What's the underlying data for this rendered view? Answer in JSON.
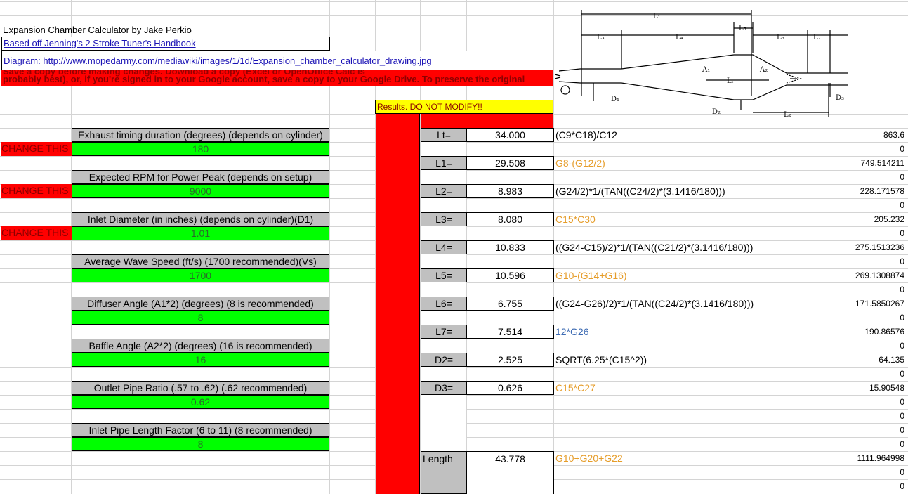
{
  "header": {
    "title": "Expansion Chamber Calculator by Jake Perkio",
    "source_link": "Based off Jenning's 2 Stroke Tuner's Handbook",
    "diagram_link": "Diagram: http://www.mopedarmy.com/mediawiki/images/1/1d/Expansion_chamber_calculator_drawing.jpg",
    "notice_text": "probably best), or, if you're signed in to your Google account, save a copy to your Google Drive. To preserve the original"
  },
  "change_label": "CHANGE THIS",
  "inputs": [
    {
      "label": "Exhaust timing duration (degrees) (depends on cylinder)",
      "value": "180",
      "required": true
    },
    {
      "label": "Expected RPM for Power Peak (depends on setup)",
      "value": "9000",
      "required": true
    },
    {
      "label": "Inlet Diameter (in inches) (depends on cylinder)(D1)",
      "value": "1.01",
      "required": true
    },
    {
      "label": "Average Wave Speed (ft/s) (1700 recommended)(Vs)",
      "value": "1700",
      "required": false
    },
    {
      "label": "Diffuser Angle (A1*2) (degrees) (8 is recommended)",
      "value": "8",
      "required": false
    },
    {
      "label": "Baffle Angle (A2*2) (degrees) (16 is recommended)",
      "value": "16",
      "required": false
    },
    {
      "label": "Outlet Pipe Ratio (.57 to .62) (.62 recommended)",
      "value": "0.62",
      "required": false
    },
    {
      "label": "Inlet Pipe Length Factor (6 to 11) (8 recommended)",
      "value": "8",
      "required": false
    }
  ],
  "results_header": "Results. DO NOT MODIFY!!",
  "results": [
    {
      "label": "Lt=",
      "value": "34.000",
      "formula": "(C9*C18)/C12",
      "formula_color": "black"
    },
    {
      "label": "L1=",
      "value": "29.508",
      "formula": "G8-(G12/2)",
      "formula_color": "orange"
    },
    {
      "label": "L2=",
      "value": "8.983",
      "formula": "(G24/2)*1/(TAN((C24/2)*(3.1416/180)))",
      "formula_color": "black"
    },
    {
      "label": "L3=",
      "value": "8.080",
      "formula": "C15*C30",
      "formula_color": "orange"
    },
    {
      "label": "L4=",
      "value": "10.833",
      "formula": "((G24-C15)/2)*1/(TAN((C21/2)*(3.1416/180)))",
      "formula_color": "black"
    },
    {
      "label": "L5=",
      "value": "10.596",
      "formula": "G10-(G14+G16)",
      "formula_color": "orange"
    },
    {
      "label": "L6=",
      "value": "6.755",
      "formula": "((G24-G26)/2)*1/(TAN((C24/2)*(3.1416/180)))",
      "formula_color": "black"
    },
    {
      "label": "L7=",
      "value": "7.514",
      "formula": "12*G26",
      "formula_color": "blue"
    },
    {
      "label": "D2=",
      "value": "2.525",
      "formula": "SQRT(6.25*(C15^2))",
      "formula_color": "black"
    },
    {
      "label": "D3=",
      "value": "0.626",
      "formula": "C15*C27",
      "formula_color": "orange"
    }
  ],
  "length_row": {
    "label": "Length",
    "value": "43.778",
    "formula": "G10+G20+G22"
  },
  "right_column": [
    "863.6",
    "0",
    "749.514211",
    "0",
    "228.171578",
    "0",
    "205.232",
    "0",
    "275.1513236",
    "0",
    "269.1308874",
    "0",
    "171.5850267",
    "0",
    "190.86576",
    "0",
    "64.135",
    "0",
    "15.90548",
    "0",
    "0",
    "0",
    "0",
    "1111.964998",
    "0",
    "0"
  ],
  "diagram": {
    "labels": {
      "L1": "L₁",
      "L2": "L₂",
      "L3": "L₃",
      "L4": "L₄",
      "L5": "L₅",
      "L6": "L₆",
      "L7": "L₇",
      "Lt": "Lₜ",
      "A1": "A₁",
      "A2": "A₂",
      "D1": "D₁",
      "D2": "D₂",
      "D3": "D₃"
    }
  }
}
